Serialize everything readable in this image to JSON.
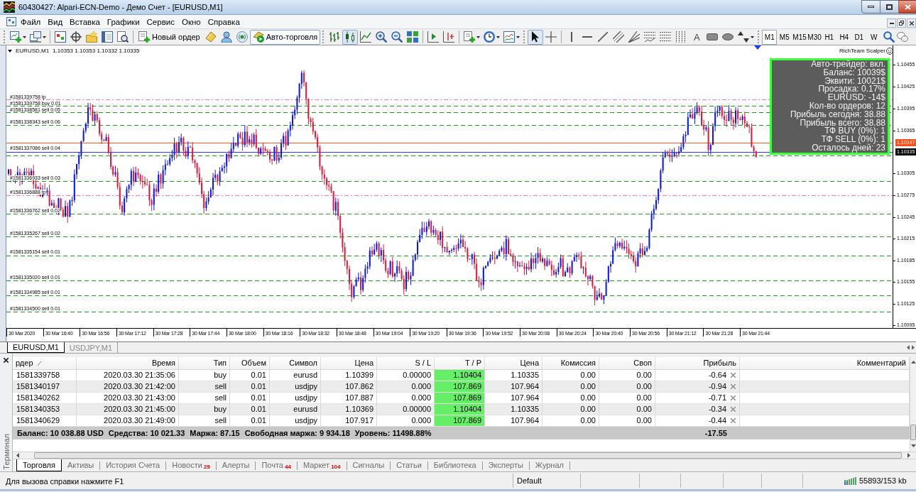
{
  "window": {
    "title": "60430427: Alpari-ECN-Demo - Демо Счет - [EURUSD,M1]"
  },
  "menu": [
    "Файл",
    "Вид",
    "Вставка",
    "Графики",
    "Сервис",
    "Окно",
    "Справка"
  ],
  "toolbar": {
    "new_order": "Новый ордер",
    "auto_trading": {
      "label": "Авто-торговля",
      "on": true
    },
    "chart_types": [
      {
        "selected": false
      },
      {
        "selected": true
      },
      {
        "selected": false
      }
    ],
    "cursor_tools": [
      {
        "selected": true
      },
      {
        "selected": false
      }
    ],
    "text_tool": "A",
    "timeframes": [
      {
        "label": "M1",
        "selected": true
      },
      {
        "label": "M5",
        "selected": false
      },
      {
        "label": "M15",
        "selected": false
      },
      {
        "label": "M30",
        "selected": false
      },
      {
        "label": "H1",
        "selected": false
      },
      {
        "label": "H4",
        "selected": false
      },
      {
        "label": "D1",
        "selected": false
      },
      {
        "label": "W",
        "selected": false
      }
    ]
  },
  "chart": {
    "symbol": "EURUSD,M1",
    "quotes": "1.10353 1.10353 1.10332 1.10335",
    "expert": "RichTeam Scalper",
    "info_panel": [
      "Авто-трейдер: вкл.",
      "Баланс: 10039$",
      "Эквити: 10021$",
      "Просадка: 0.17%",
      "EURUSD: -14$",
      "Кол-во ордеров: 12",
      "Прибыль сегодня: 38.88",
      "Прибыль всего: 38.88",
      "ТФ BUY (0%): 1",
      "ТФ SELL (0%): 1",
      "Осталось дней: 23"
    ],
    "order_lines": [
      {
        "label": "#1581339758 tp",
        "kind": "tp"
      },
      {
        "label": "#1581339758 buy 0.01",
        "kind": "order"
      },
      {
        "label": "#1581338581 sell 0.05",
        "kind": "order"
      },
      {
        "label": "#1581338343 sell 0.06",
        "kind": "order"
      },
      {
        "label": "#1581337086 sell 0.04",
        "kind": "order"
      },
      {
        "label": "#1581336933 sell 0.03",
        "kind": "order"
      },
      {
        "label": "#1581336888 tp",
        "kind": "tp"
      },
      {
        "label": "#1581336762 sell 0.02",
        "kind": "order"
      },
      {
        "label": "#1581335267 sell 0.02",
        "kind": "order"
      },
      {
        "label": "#1581335154 sell 0.01",
        "kind": "order"
      },
      {
        "label": "#1581335020 sell 0.01",
        "kind": "order"
      },
      {
        "label": "#1581334985 sell 0.01",
        "kind": "order"
      },
      {
        "label": "#1581334500 sell 0.01",
        "kind": "order"
      }
    ],
    "price_axis": [
      "1.10455",
      "1.10425",
      "1.10395",
      "1.10365",
      "1.10305",
      "1.10275",
      "1.10245",
      "1.10215",
      "1.10185",
      "1.10155",
      "1.10125",
      "1.10095"
    ],
    "price_tags": [
      {
        "text": "1.10347",
        "kind": "ask"
      },
      {
        "text": "1.10335",
        "kind": "bid"
      }
    ],
    "time_axis": [
      "30 Mar 2020",
      "30 Mar 16:40",
      "30 Mar 16:56",
      "30 Mar 17:12",
      "30 Mar 17:28",
      "30 Mar 17:44",
      "30 Mar 18:00",
      "30 Mar 18:16",
      "30 Mar 18:32",
      "30 Mar 18:48",
      "30 Mar 19:04",
      "30 Mar 19:20",
      "30 Mar 19:36",
      "30 Mar 19:52",
      "30 Mar 20:08",
      "30 Mar 20:24",
      "30 Mar 20:40",
      "30 Mar 20:56",
      "30 Mar 21:12",
      "30 Mar 21:28",
      "30 Mar 21:44"
    ]
  },
  "chart_tabs": [
    {
      "label": "EURUSD,M1",
      "selected": true
    },
    {
      "label": "USDJPY,M1",
      "selected": false
    }
  ],
  "terminal": {
    "title": "Терминал",
    "columns": [
      {
        "label": "рдер",
        "highlight": false,
        "sorted": true
      },
      {
        "label": "Время",
        "highlight": false,
        "sorted": false
      },
      {
        "label": "Тип",
        "highlight": false,
        "sorted": false
      },
      {
        "label": "Объем",
        "highlight": false,
        "sorted": false
      },
      {
        "label": "Символ",
        "highlight": false,
        "sorted": false
      },
      {
        "label": "Цена",
        "highlight": false,
        "sorted": false
      },
      {
        "label": "S / L",
        "highlight": false,
        "sorted": false
      },
      {
        "label": "T / P",
        "highlight": true,
        "sorted": false
      },
      {
        "label": "Цена",
        "highlight": false,
        "sorted": false
      },
      {
        "label": "Комиссия",
        "highlight": false,
        "sorted": false
      },
      {
        "label": "Своп",
        "highlight": false,
        "sorted": false
      },
      {
        "label": "Прибыль",
        "highlight": false,
        "sorted": false
      },
      {
        "label": "Комментарий",
        "highlight": false,
        "sorted": false
      }
    ],
    "rows": [
      [
        "1581339758",
        "2020.03.30 21:35:06",
        "buy",
        "0.01",
        "eurusd",
        "1.10399",
        "0.00000",
        "1.10404",
        "1.10335",
        "0.00",
        "0.00",
        "-0.64"
      ],
      [
        "1581340197",
        "2020.03.30 21:42:00",
        "sell",
        "0.01",
        "usdjpy",
        "107.862",
        "0.000",
        "107.869",
        "107.964",
        "0.00",
        "0.00",
        "-0.94"
      ],
      [
        "1581340262",
        "2020.03.30 21:43:00",
        "sell",
        "0.01",
        "usdjpy",
        "107.887",
        "0.000",
        "107.869",
        "107.964",
        "0.00",
        "0.00",
        "-0.71"
      ],
      [
        "1581340353",
        "2020.03.30 21:45:00",
        "buy",
        "0.01",
        "eurusd",
        "1.10369",
        "0.00000",
        "1.10404",
        "1.10335",
        "0.00",
        "0.00",
        "-0.34"
      ],
      [
        "1581340629",
        "2020.03.30 21:49:00",
        "sell",
        "0.01",
        "usdjpy",
        "107.917",
        "0.000",
        "107.869",
        "107.964",
        "0.00",
        "0.00",
        "-0.44"
      ]
    ],
    "summary": [
      "Баланс: 10 038.88 USD",
      "Средства: 10 021.33",
      "Маржа: 87.15",
      "Свободная маржа: 9 934.18",
      "Уровень: 11498.88%"
    ],
    "total_profit": "-17.55",
    "tabs": [
      {
        "label": "Торговля",
        "selected": true
      },
      {
        "label": "Активы",
        "selected": false
      },
      {
        "label": "История Счета",
        "selected": false
      },
      {
        "label": "Новости",
        "badge": "29",
        "selected": false
      },
      {
        "label": "Алерты",
        "selected": false
      },
      {
        "label": "Почта",
        "badge": "44",
        "selected": false
      },
      {
        "label": "Маркет",
        "badge": "104",
        "selected": false
      },
      {
        "label": "Сигналы",
        "selected": false
      },
      {
        "label": "Статьи",
        "selected": false
      },
      {
        "label": "Библиотека",
        "selected": false
      },
      {
        "label": "Эксперты",
        "selected": false
      },
      {
        "label": "Журнал",
        "selected": false
      }
    ]
  },
  "status_bar": {
    "hint": "Для вызова справки нажмите F1",
    "profile": "Default",
    "traffic": "55893/153 kb"
  }
}
